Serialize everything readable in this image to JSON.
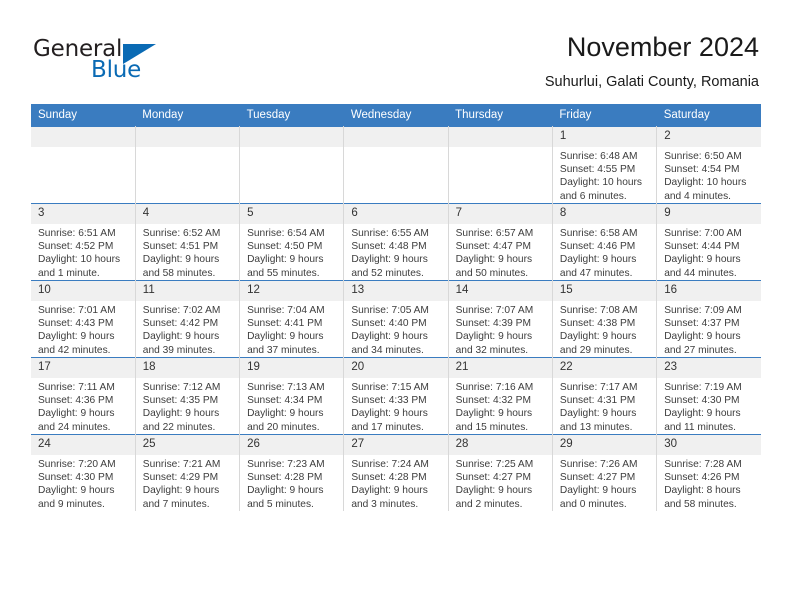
{
  "brand": {
    "name_part1": "General",
    "name_part2": "Blue",
    "triangle_icon": "blue-triangle-icon",
    "accent_color": "#0a6ab4"
  },
  "header": {
    "title": "November 2024",
    "subtitle": "Suhurlui, Galati County, Romania"
  },
  "theme": {
    "header_blue": "#3a7cc0",
    "daynum_band": "#f0f0f0",
    "text": "#3d3d3d"
  },
  "weekdays": [
    "Sunday",
    "Monday",
    "Tuesday",
    "Wednesday",
    "Thursday",
    "Friday",
    "Saturday"
  ],
  "labels": {
    "sunrise": "Sunrise:",
    "sunset": "Sunset:",
    "daylight": "Daylight:"
  },
  "weeks": [
    [
      {
        "day": "",
        "empty": true
      },
      {
        "day": "",
        "empty": true
      },
      {
        "day": "",
        "empty": true
      },
      {
        "day": "",
        "empty": true
      },
      {
        "day": "",
        "empty": true
      },
      {
        "day": "1",
        "sunrise": "Sunrise: 6:48 AM",
        "sunset": "Sunset: 4:55 PM",
        "daylight_1": "Daylight: 10 hours",
        "daylight_2": "and 6 minutes."
      },
      {
        "day": "2",
        "sunrise": "Sunrise: 6:50 AM",
        "sunset": "Sunset: 4:54 PM",
        "daylight_1": "Daylight: 10 hours",
        "daylight_2": "and 4 minutes."
      }
    ],
    [
      {
        "day": "3",
        "sunrise": "Sunrise: 6:51 AM",
        "sunset": "Sunset: 4:52 PM",
        "daylight_1": "Daylight: 10 hours",
        "daylight_2": "and 1 minute."
      },
      {
        "day": "4",
        "sunrise": "Sunrise: 6:52 AM",
        "sunset": "Sunset: 4:51 PM",
        "daylight_1": "Daylight: 9 hours",
        "daylight_2": "and 58 minutes."
      },
      {
        "day": "5",
        "sunrise": "Sunrise: 6:54 AM",
        "sunset": "Sunset: 4:50 PM",
        "daylight_1": "Daylight: 9 hours",
        "daylight_2": "and 55 minutes."
      },
      {
        "day": "6",
        "sunrise": "Sunrise: 6:55 AM",
        "sunset": "Sunset: 4:48 PM",
        "daylight_1": "Daylight: 9 hours",
        "daylight_2": "and 52 minutes."
      },
      {
        "day": "7",
        "sunrise": "Sunrise: 6:57 AM",
        "sunset": "Sunset: 4:47 PM",
        "daylight_1": "Daylight: 9 hours",
        "daylight_2": "and 50 minutes."
      },
      {
        "day": "8",
        "sunrise": "Sunrise: 6:58 AM",
        "sunset": "Sunset: 4:46 PM",
        "daylight_1": "Daylight: 9 hours",
        "daylight_2": "and 47 minutes."
      },
      {
        "day": "9",
        "sunrise": "Sunrise: 7:00 AM",
        "sunset": "Sunset: 4:44 PM",
        "daylight_1": "Daylight: 9 hours",
        "daylight_2": "and 44 minutes."
      }
    ],
    [
      {
        "day": "10",
        "sunrise": "Sunrise: 7:01 AM",
        "sunset": "Sunset: 4:43 PM",
        "daylight_1": "Daylight: 9 hours",
        "daylight_2": "and 42 minutes."
      },
      {
        "day": "11",
        "sunrise": "Sunrise: 7:02 AM",
        "sunset": "Sunset: 4:42 PM",
        "daylight_1": "Daylight: 9 hours",
        "daylight_2": "and 39 minutes."
      },
      {
        "day": "12",
        "sunrise": "Sunrise: 7:04 AM",
        "sunset": "Sunset: 4:41 PM",
        "daylight_1": "Daylight: 9 hours",
        "daylight_2": "and 37 minutes."
      },
      {
        "day": "13",
        "sunrise": "Sunrise: 7:05 AM",
        "sunset": "Sunset: 4:40 PM",
        "daylight_1": "Daylight: 9 hours",
        "daylight_2": "and 34 minutes."
      },
      {
        "day": "14",
        "sunrise": "Sunrise: 7:07 AM",
        "sunset": "Sunset: 4:39 PM",
        "daylight_1": "Daylight: 9 hours",
        "daylight_2": "and 32 minutes."
      },
      {
        "day": "15",
        "sunrise": "Sunrise: 7:08 AM",
        "sunset": "Sunset: 4:38 PM",
        "daylight_1": "Daylight: 9 hours",
        "daylight_2": "and 29 minutes."
      },
      {
        "day": "16",
        "sunrise": "Sunrise: 7:09 AM",
        "sunset": "Sunset: 4:37 PM",
        "daylight_1": "Daylight: 9 hours",
        "daylight_2": "and 27 minutes."
      }
    ],
    [
      {
        "day": "17",
        "sunrise": "Sunrise: 7:11 AM",
        "sunset": "Sunset: 4:36 PM",
        "daylight_1": "Daylight: 9 hours",
        "daylight_2": "and 24 minutes."
      },
      {
        "day": "18",
        "sunrise": "Sunrise: 7:12 AM",
        "sunset": "Sunset: 4:35 PM",
        "daylight_1": "Daylight: 9 hours",
        "daylight_2": "and 22 minutes."
      },
      {
        "day": "19",
        "sunrise": "Sunrise: 7:13 AM",
        "sunset": "Sunset: 4:34 PM",
        "daylight_1": "Daylight: 9 hours",
        "daylight_2": "and 20 minutes."
      },
      {
        "day": "20",
        "sunrise": "Sunrise: 7:15 AM",
        "sunset": "Sunset: 4:33 PM",
        "daylight_1": "Daylight: 9 hours",
        "daylight_2": "and 17 minutes."
      },
      {
        "day": "21",
        "sunrise": "Sunrise: 7:16 AM",
        "sunset": "Sunset: 4:32 PM",
        "daylight_1": "Daylight: 9 hours",
        "daylight_2": "and 15 minutes."
      },
      {
        "day": "22",
        "sunrise": "Sunrise: 7:17 AM",
        "sunset": "Sunset: 4:31 PM",
        "daylight_1": "Daylight: 9 hours",
        "daylight_2": "and 13 minutes."
      },
      {
        "day": "23",
        "sunrise": "Sunrise: 7:19 AM",
        "sunset": "Sunset: 4:30 PM",
        "daylight_1": "Daylight: 9 hours",
        "daylight_2": "and 11 minutes."
      }
    ],
    [
      {
        "day": "24",
        "sunrise": "Sunrise: 7:20 AM",
        "sunset": "Sunset: 4:30 PM",
        "daylight_1": "Daylight: 9 hours",
        "daylight_2": "and 9 minutes."
      },
      {
        "day": "25",
        "sunrise": "Sunrise: 7:21 AM",
        "sunset": "Sunset: 4:29 PM",
        "daylight_1": "Daylight: 9 hours",
        "daylight_2": "and 7 minutes."
      },
      {
        "day": "26",
        "sunrise": "Sunrise: 7:23 AM",
        "sunset": "Sunset: 4:28 PM",
        "daylight_1": "Daylight: 9 hours",
        "daylight_2": "and 5 minutes."
      },
      {
        "day": "27",
        "sunrise": "Sunrise: 7:24 AM",
        "sunset": "Sunset: 4:28 PM",
        "daylight_1": "Daylight: 9 hours",
        "daylight_2": "and 3 minutes."
      },
      {
        "day": "28",
        "sunrise": "Sunrise: 7:25 AM",
        "sunset": "Sunset: 4:27 PM",
        "daylight_1": "Daylight: 9 hours",
        "daylight_2": "and 2 minutes."
      },
      {
        "day": "29",
        "sunrise": "Sunrise: 7:26 AM",
        "sunset": "Sunset: 4:27 PM",
        "daylight_1": "Daylight: 9 hours",
        "daylight_2": "and 0 minutes."
      },
      {
        "day": "30",
        "sunrise": "Sunrise: 7:28 AM",
        "sunset": "Sunset: 4:26 PM",
        "daylight_1": "Daylight: 8 hours",
        "daylight_2": "and 58 minutes."
      }
    ]
  ]
}
